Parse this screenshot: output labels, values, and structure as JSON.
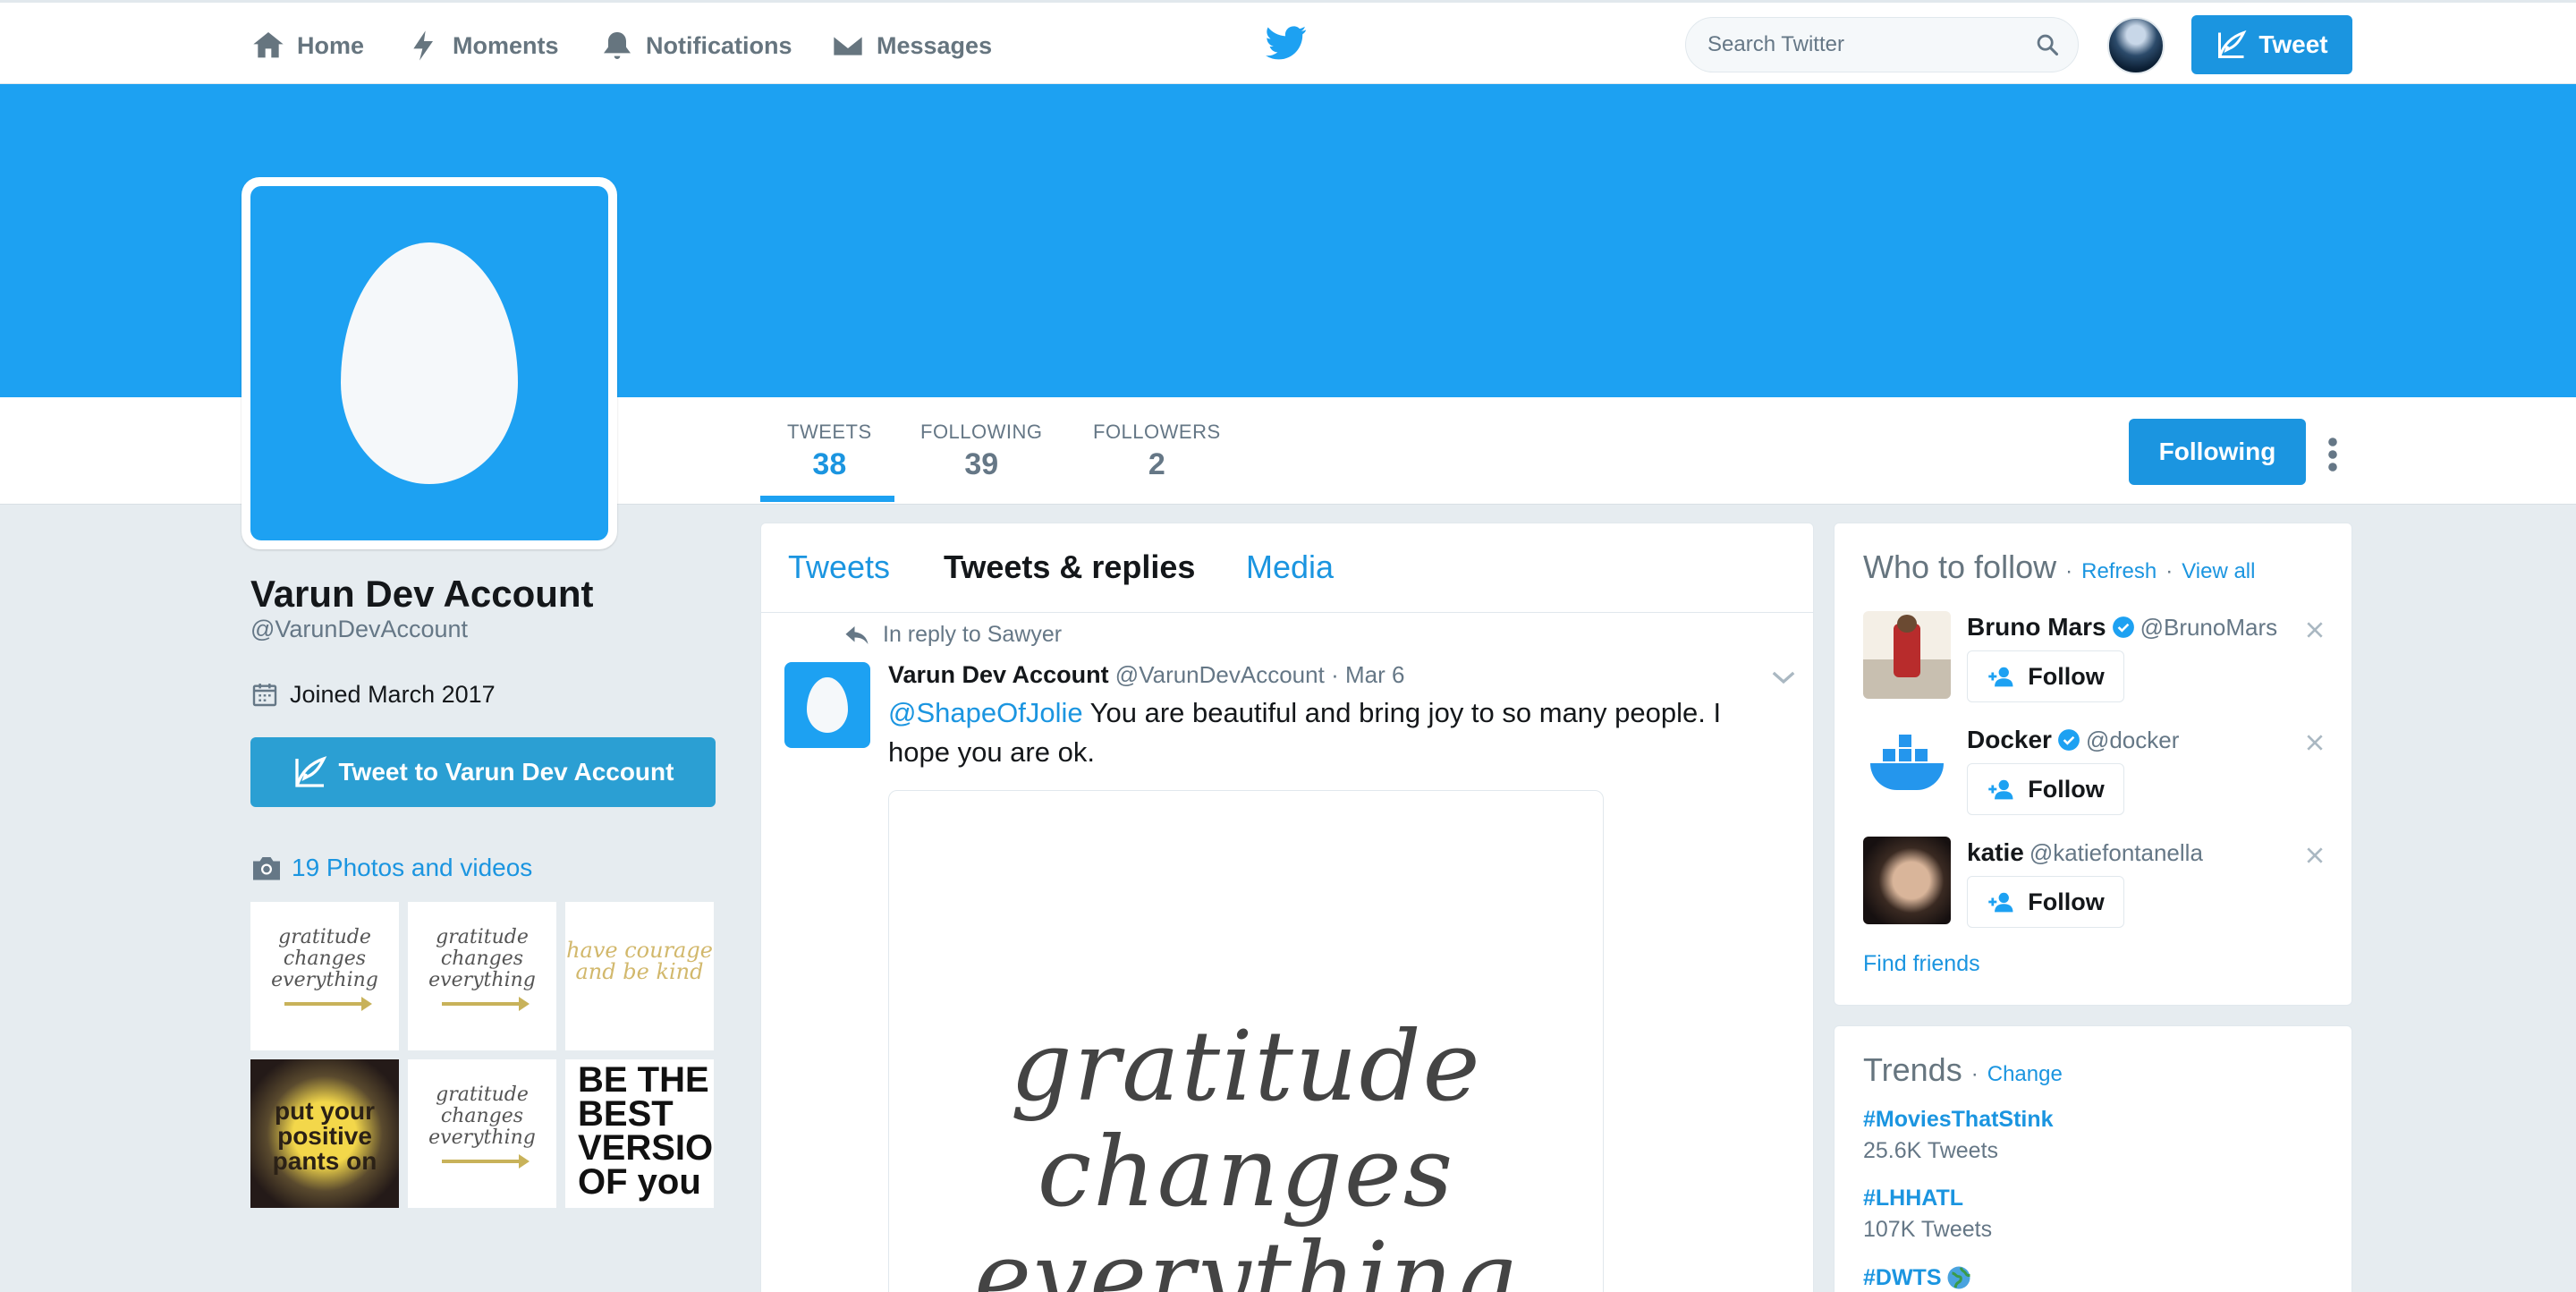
{
  "nav": {
    "items": [
      {
        "label": "Home",
        "icon": "home-icon"
      },
      {
        "label": "Moments",
        "icon": "lightning-icon"
      },
      {
        "label": "Notifications",
        "icon": "bell-icon"
      },
      {
        "label": "Messages",
        "icon": "envelope-icon"
      }
    ],
    "search_placeholder": "Search Twitter",
    "tweet_button": "Tweet"
  },
  "profile": {
    "name": "Varun Dev Account",
    "handle": "@VarunDevAccount",
    "joined": "Joined March 2017",
    "tweet_to_label": "Tweet to Varun Dev Account",
    "photos_label": "19 Photos and videos",
    "following_button": "Following",
    "stats": [
      {
        "label": "TWEETS",
        "value": "38"
      },
      {
        "label": "FOLLOWING",
        "value": "39"
      },
      {
        "label": "FOLLOWERS",
        "value": "2"
      }
    ],
    "thumbs": [
      {
        "text": "gratitude changes everything"
      },
      {
        "text": "gratitude changes everything"
      },
      {
        "text": "have courage and be kind"
      },
      {
        "text": "put your positive pants on"
      },
      {
        "text": "gratitude changes everything"
      },
      {
        "text": "BE THE BEST VERSION OF you"
      }
    ]
  },
  "timeline": {
    "tabs": [
      "Tweets",
      "Tweets & replies",
      "Media"
    ],
    "tweet": {
      "reply_context": "In reply to Sawyer",
      "author": "Varun Dev Account",
      "handle": "@VarunDevAccount",
      "date": "· Mar 6",
      "mention": "@ShapeOfJolie",
      "text": " You are beautiful and bring joy to so many people. I hope you are ok.",
      "media_text": "gratitude changes everything"
    }
  },
  "who_to_follow": {
    "title": "Who to follow",
    "refresh": "Refresh",
    "view_all": "View all",
    "separator": "·",
    "follow_label": "Follow",
    "suggestions": [
      {
        "name": "Bruno Mars",
        "handle": "@BrunoMars",
        "verified": true
      },
      {
        "name": "Docker",
        "handle": "@docker",
        "verified": true
      },
      {
        "name": "katie",
        "handle": "@katiefontanella",
        "verified": false
      }
    ],
    "find_friends": "Find friends"
  },
  "trends": {
    "title": "Trends",
    "change": "Change",
    "items": [
      {
        "name": "#MoviesThatStink",
        "count": "25.6K Tweets"
      },
      {
        "name": "#LHHATL",
        "count": "107K Tweets"
      },
      {
        "name": "#DWTS",
        "count": ""
      }
    ]
  },
  "colors": {
    "brand": "#1da1f2",
    "link": "#1b95e0",
    "background": "#e6ecf0"
  }
}
